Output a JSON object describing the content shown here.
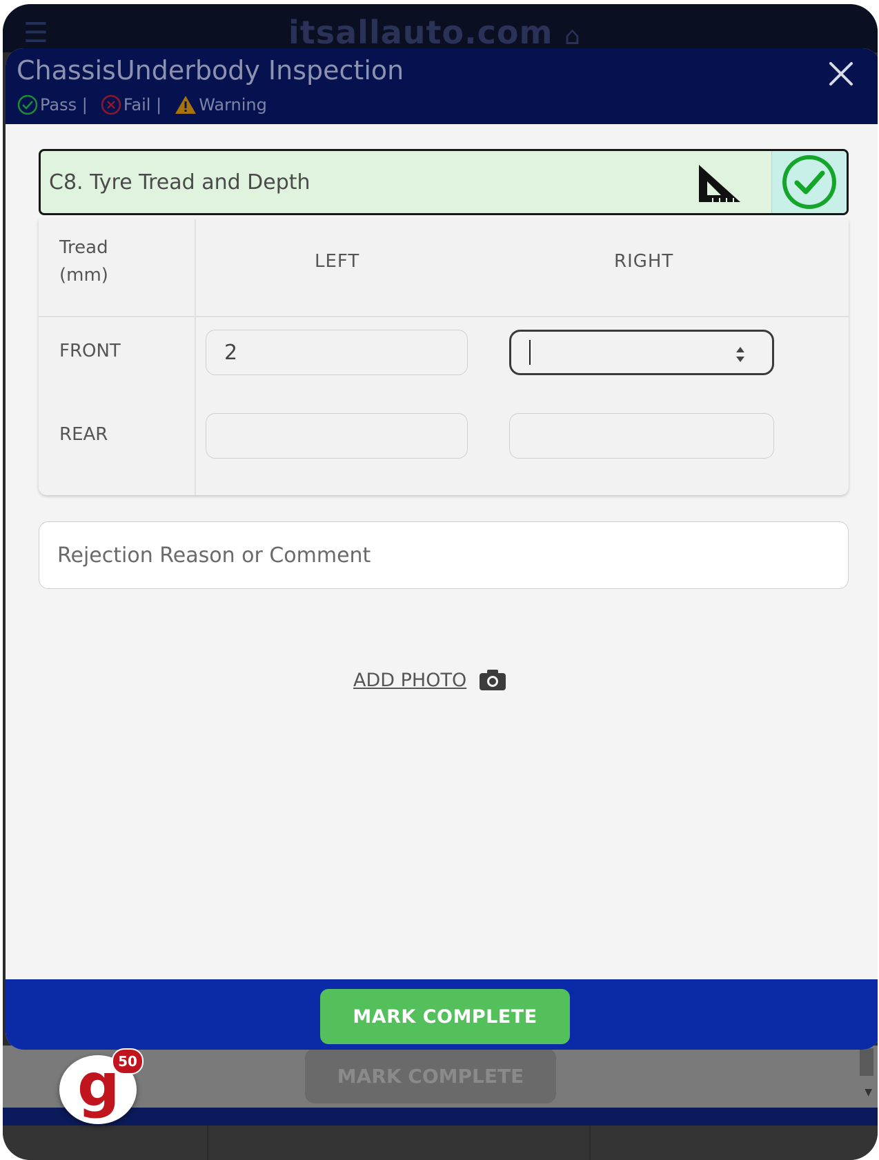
{
  "background": {
    "brand": "itsallauto.com",
    "mark_complete_label": "MARK COMPLETE"
  },
  "modal": {
    "title": "ChassisUnderbody Inspection",
    "legend": {
      "pass_label": "Pass |",
      "fail_label": "Fail |",
      "warning_label": "Warning"
    }
  },
  "item": {
    "title": "C8. Tyre Tread and Depth",
    "status": "pass"
  },
  "tread_table": {
    "corner_label_line1": "Tread",
    "corner_label_line2": "(mm)",
    "columns": [
      "LEFT",
      "RIGHT"
    ],
    "rows": [
      {
        "label": "FRONT",
        "left": "2",
        "right": ""
      },
      {
        "label": "REAR",
        "left": "",
        "right": ""
      }
    ]
  },
  "comment": {
    "placeholder": "Rejection Reason or Comment"
  },
  "add_photo": {
    "label": "ADD PHOTO"
  },
  "footer": {
    "mark_complete_label": "MARK COMPLETE"
  },
  "floating_badge": {
    "letter": "g",
    "count": "50"
  },
  "colors": {
    "header_bg": "#06124f",
    "footer_bg": "#0b2aa8",
    "mark_complete": "#53c05c",
    "item_card_bg": "#dff3df",
    "pass": "#14a52a",
    "fail": "#c0141e",
    "warning": "#e0a000"
  }
}
